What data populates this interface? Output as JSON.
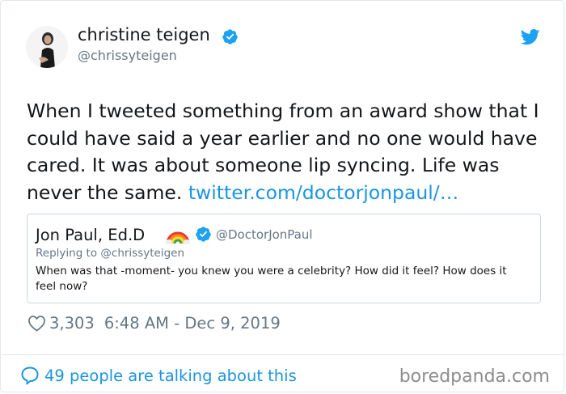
{
  "author": {
    "display_name": "christine teigen",
    "handle": "@chrissyteigen",
    "verified": true
  },
  "tweet": {
    "text": "When I tweeted something from an award show that I could have said a year earlier and no one would have cared. It was about someone lip syncing. Life was never the same.",
    "link": "twitter.com/doctorjonpaul/…"
  },
  "quoted_tweet": {
    "name": "Jon Paul, Ed.D",
    "emoji": "rainbow",
    "handle": "@DoctorJonPaul",
    "replying_to": "Replying to @chrissyteigen",
    "text": "When was that -moment- you knew you were a celebrity? How did it feel? How does it feel now?"
  },
  "meta": {
    "likes": "3,303",
    "timestamp": "6:48 AM - Dec 9, 2019"
  },
  "footer": {
    "talking": "49 people are talking about this",
    "watermark": "boredpanda.com"
  },
  "colors": {
    "link": "#1b95e0",
    "verified": "#1da1f2",
    "secondary_text": "#657786",
    "border": "#e1e8ed"
  },
  "icons": [
    "profile-avatar",
    "verified-badge-icon",
    "twitter-bird-icon",
    "rainbow-icon",
    "heart-icon",
    "reply-bubble-icon"
  ]
}
